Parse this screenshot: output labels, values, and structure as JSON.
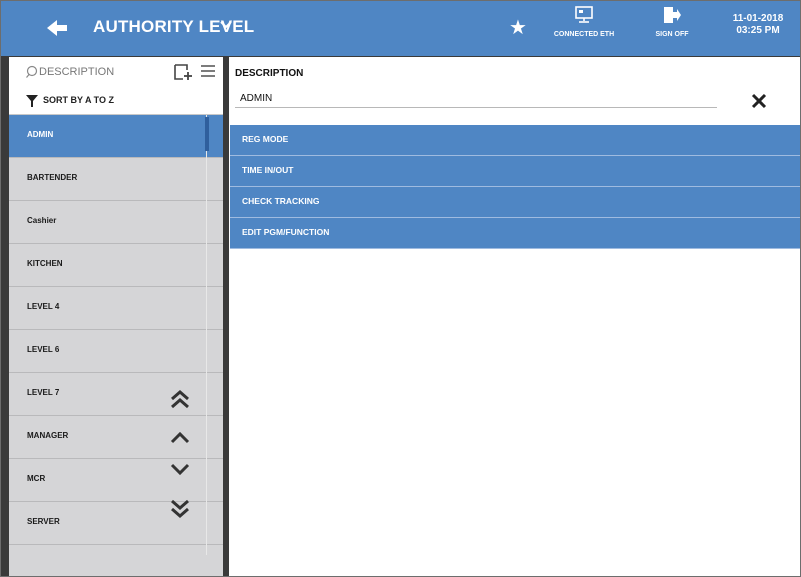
{
  "header": {
    "back_icon": "back-arrow-icon",
    "title": "AUTHORITY LEVEL",
    "title_dropdown_icon": "chevron-down-icon",
    "favorite_icon": "star-icon",
    "connection_label": "CONNECTED ETH",
    "connection_icon": "network-monitor-icon",
    "signoff_label": "SIGN OFF",
    "signoff_icon": "exit-door-icon",
    "date": "11-01-2018",
    "time": "03:25 PM"
  },
  "sidebar": {
    "search_placeholder": "DESCRIPTION",
    "sort_label": "SORT BY A TO Z",
    "items": [
      {
        "label": "ADMIN",
        "selected": true
      },
      {
        "label": "BARTENDER"
      },
      {
        "label": "Cashier"
      },
      {
        "label": "KITCHEN"
      },
      {
        "label": "LEVEL 4"
      },
      {
        "label": "LEVEL 6"
      },
      {
        "label": "LEVEL 7"
      },
      {
        "label": "MANAGER"
      },
      {
        "label": "MCR"
      },
      {
        "label": "SERVER"
      }
    ],
    "nav_icons": [
      "double-chevron-up-icon",
      "chevron-up-icon",
      "chevron-down-icon",
      "double-chevron-down-icon"
    ]
  },
  "detail": {
    "description_label": "DESCRIPTION",
    "description_value": "ADMIN",
    "options": [
      "REG MODE",
      "TIME IN/OUT",
      "CHECK TRACKING",
      "EDIT PGM/FUNCTION"
    ]
  },
  "colors": {
    "accent": "#4f86c4",
    "sidebar_bg": "#d5d5d7",
    "scroll_thumb": "#2f5f9d"
  }
}
